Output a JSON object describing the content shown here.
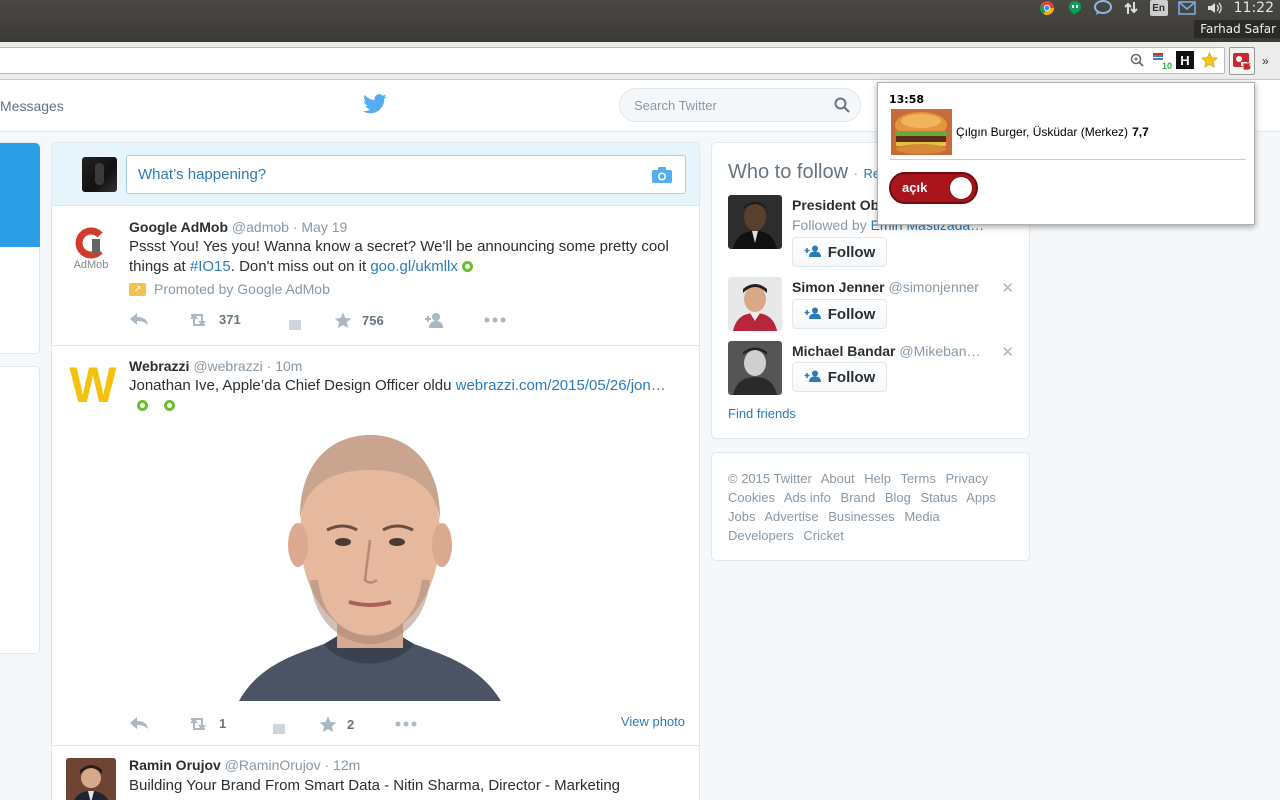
{
  "os": {
    "time": "11:22",
    "user": "Farhad Safar",
    "keyboard": "En"
  },
  "header": {
    "messages": "Messages",
    "search_placeholder": "Search Twitter"
  },
  "compose": {
    "placeholder": "What’s happening?"
  },
  "tweets": [
    {
      "name": "Google AdMob",
      "handle": "@admob",
      "time": "· May 19",
      "avatar_label": "AdMob",
      "text_a": "Pssst You! Yes you! Wanna know a secret? We'll be announcing some pretty cool things at ",
      "hashtag": "#IO15",
      "text_b": ". Don't miss out on it ",
      "link": "goo.gl/ukmllx",
      "promoted": "Promoted by Google AdMob",
      "retweets": "371",
      "favorites": "756"
    },
    {
      "name": "Webrazzi",
      "handle": "@webrazzi",
      "time": "· 10m",
      "avatar_label": "W",
      "text_a": "Jonathan Ive, Apple’da Chief Design Officer oldu ",
      "link": "webrazzi.com/2015/05/26/jon…",
      "retweets": "1",
      "favorites": "2",
      "view_photo": "View photo"
    },
    {
      "name": "Ramin Orujov",
      "handle": "@RaminOrujov",
      "time": "· 12m",
      "text_a": "Building Your Brand From Smart Data - Nitin Sharma, Director - Marketing"
    }
  ],
  "who_to_follow": {
    "title": "Who to follow",
    "dot": "·",
    "refresh": "Ref",
    "users": [
      {
        "name": "President Ob",
        "handle": "",
        "followed_by_prefix": "Followed by ",
        "followed_by": "Emin Mastizada…",
        "follow": "Follow"
      },
      {
        "name": "Simon Jenner",
        "handle": "@simonjenner",
        "follow": "Follow"
      },
      {
        "name": "Michael Bandar",
        "handle": "@Mikeban…",
        "follow": "Follow"
      }
    ],
    "find_friends": "Find friends"
  },
  "footer": {
    "links": [
      "© 2015 Twitter",
      "About",
      "Help",
      "Terms",
      "Privacy",
      "Cookies",
      "Ads info",
      "Brand",
      "Blog",
      "Status",
      "Apps",
      "Jobs",
      "Advertise",
      "Businesses",
      "Media",
      "Developers",
      "Cricket"
    ]
  },
  "popup": {
    "time": "13:58",
    "place": "Çılgın Burger, Üsküdar (Merkez)",
    "score": "7,7",
    "toggle_label": "açık",
    "toggle_on": true
  },
  "chrome": {
    "ext_badge": "1",
    "counter_badge": "10",
    "h_icon": "H"
  },
  "colors": {
    "twitter_blue": "#55acee",
    "link": "#2b7bb9",
    "toggle_red": "#a8151c"
  }
}
